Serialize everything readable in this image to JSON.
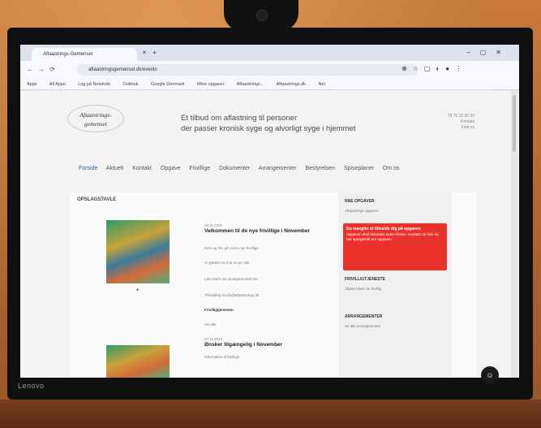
{
  "environment": {
    "monitor_brand": "Lenovo"
  },
  "browser": {
    "tab_title": "Aftaastrings-Gemenset",
    "url": "aftaastringsgemenset.dk/events",
    "bookmarks": [
      "Apps",
      "All Apps",
      "Log på Netskole",
      "Outlook",
      "Google Denmark",
      "Mine opgaver",
      "Aftaastrings...",
      "Aftaastrings.dk",
      "Net"
    ]
  },
  "site": {
    "logo_text": "Aftaastrings- gemenset",
    "tagline_line1": "Et tilbud om aflastning til personer",
    "tagline_line2": "der passer kronisk syge og alvorligt syge i hjemmet",
    "header_right": [
      "Tlf 70 10 20 30",
      "Kontakt",
      "Find os"
    ],
    "nav": [
      "Forside",
      "Aktuelt",
      "Kontakt",
      "Opgave",
      "Frivillige",
      "Dokumenter",
      "Arrangementer",
      "Bestyrelsen",
      "Spiseplaner",
      "Om os"
    ],
    "section_title": "OPSLAGSTAVLE",
    "post1": {
      "date": "08.11.2023",
      "title": "Velkommen til de nye frivillige i November",
      "lines": [
        "Kom og hils på vores nye frivillige",
        "Vi glæder os til at se jer alle",
        "Læs mere om arrangementet her",
        "Tilmelding til info@aftaastrings.dk"
      ],
      "bold": "Frivilligtjenesten",
      "extra": "Vis alle"
    },
    "post2": {
      "date": "07.11.2023",
      "title": "Ønsker tilgængelig i November",
      "lines": [
        "Information til frivillige"
      ]
    },
    "sidebar": {
      "h1": "NNE OPGAVER",
      "t1": "Aftaastrings opgaver",
      "alert_title": "Du mangler at tilmelde dig på opgaven",
      "alert_body": "Opgaven skal tilmeldes inden fristen. Kontakt os hvis du har spørgsmål om opgaven.",
      "h2": "FRIVILLIGTJENESTE",
      "t2": "Sådan bliver du frivillig",
      "h3": "ARRANGEMENTER",
      "t3": "Se alle arrangementer"
    }
  }
}
